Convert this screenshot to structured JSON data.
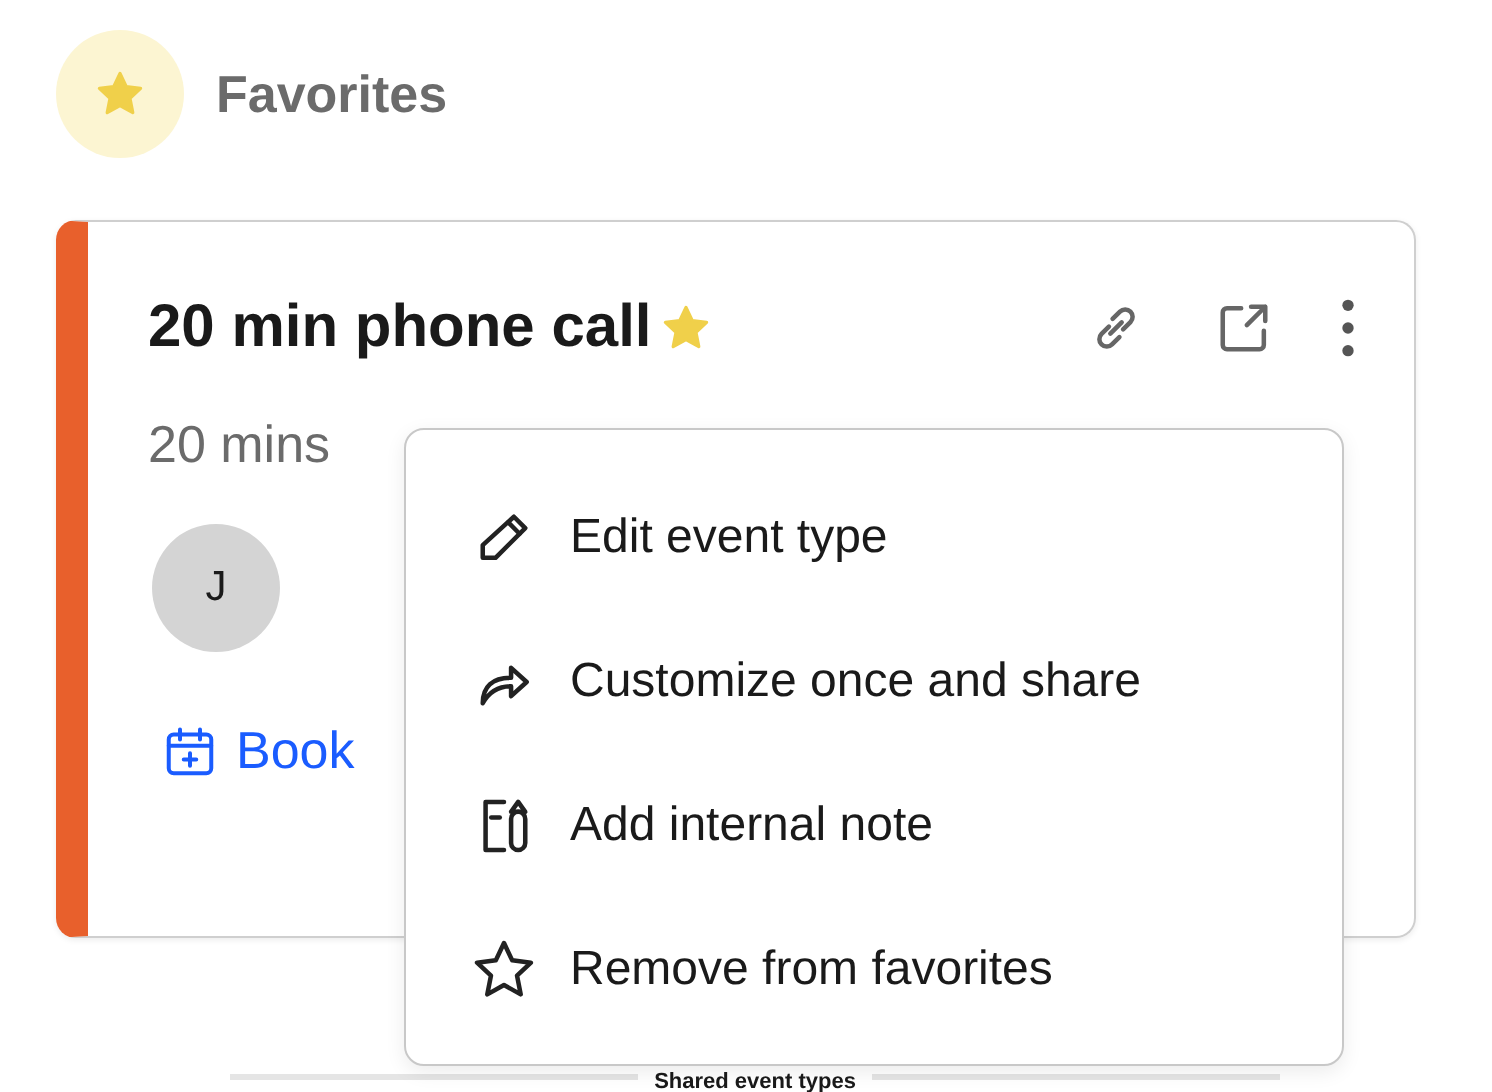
{
  "section": {
    "title": "Favorites"
  },
  "card": {
    "title": "20 min phone call",
    "favorite": true,
    "duration": "20 mins",
    "avatar": "J",
    "book_link": "Book"
  },
  "menu": {
    "items": [
      {
        "kind": "edit",
        "label": "Edit event type"
      },
      {
        "kind": "share",
        "label": "Customize once and share"
      },
      {
        "kind": "note",
        "label": "Add internal note"
      },
      {
        "kind": "unfavorite",
        "label": "Remove from favorites"
      }
    ]
  },
  "next_section": {
    "title": "Shared event types"
  }
}
